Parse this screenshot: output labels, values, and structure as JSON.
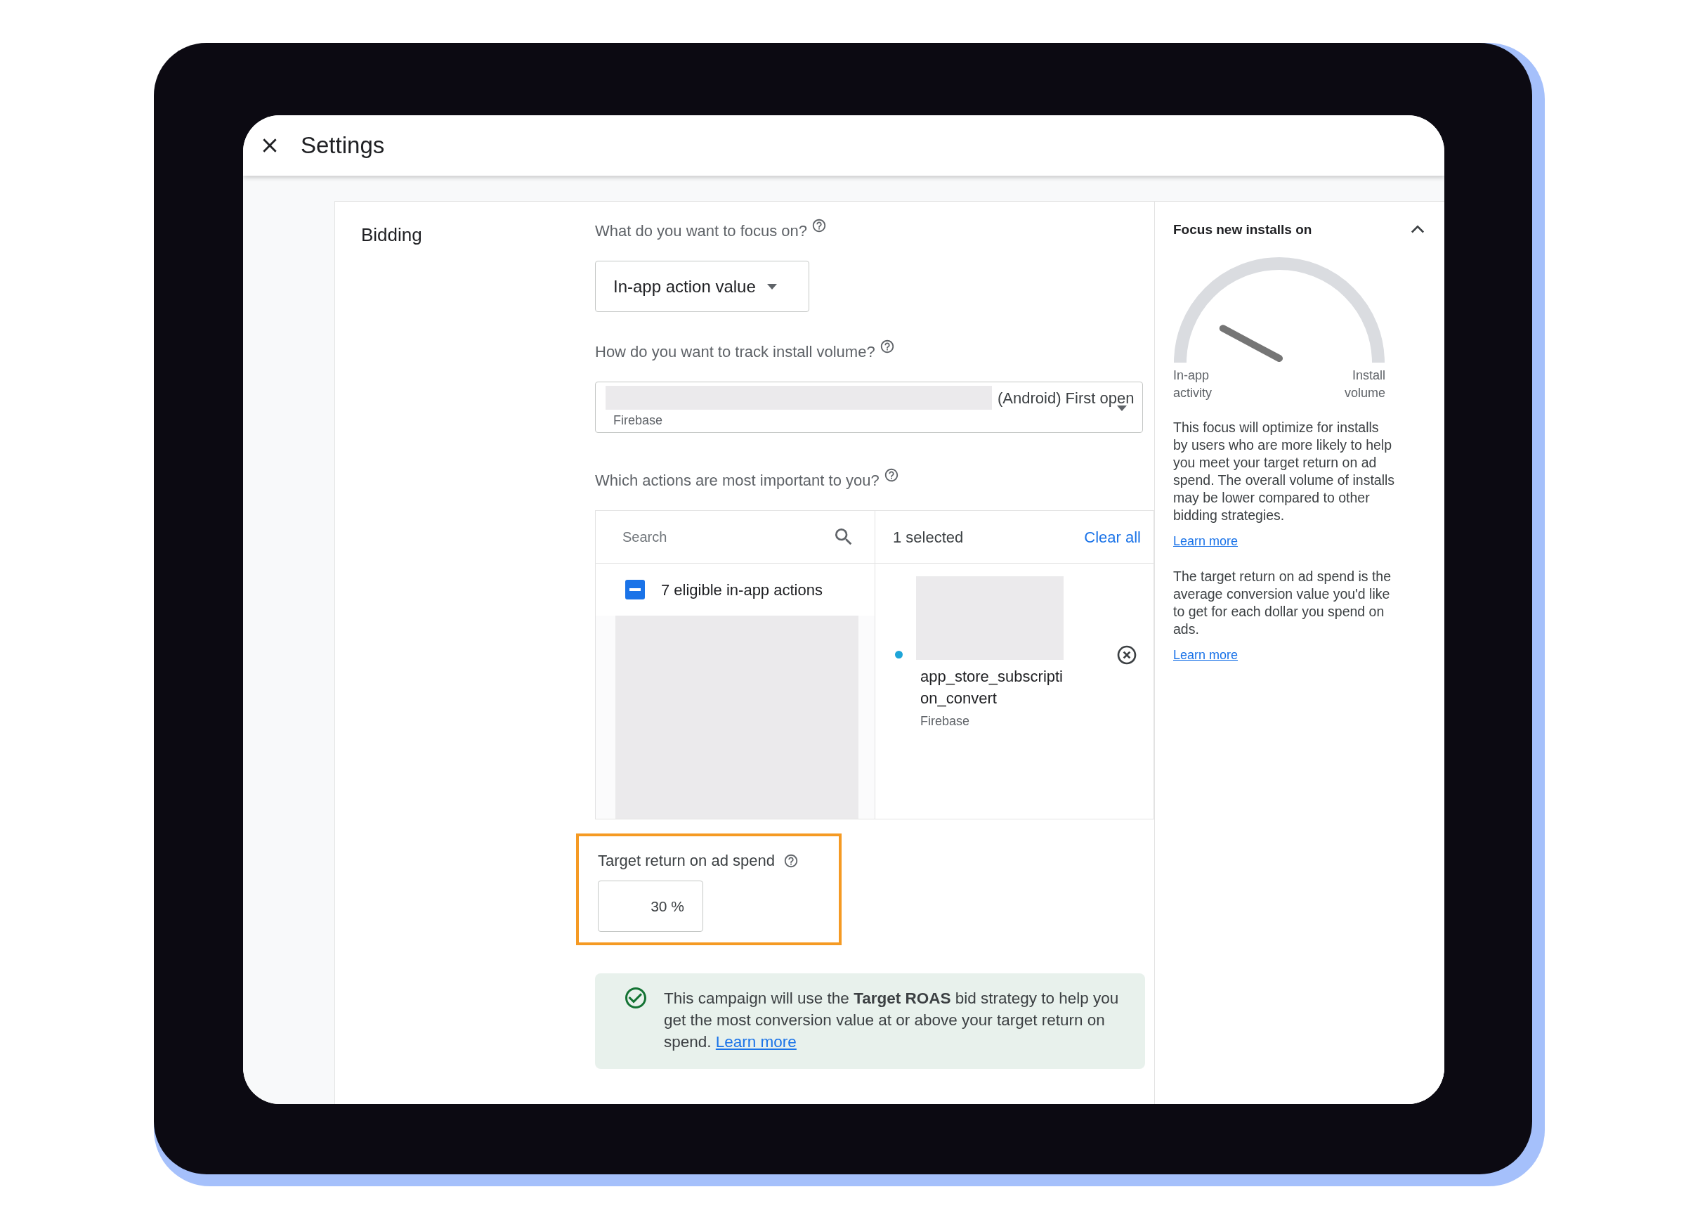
{
  "dialog": {
    "title": "Settings"
  },
  "section": {
    "title": "Bidding"
  },
  "focus_question": {
    "label": "What do you want to focus on?"
  },
  "focus_dropdown": {
    "value": "In-app action value"
  },
  "install_question": {
    "label": "How do you want to track install volume?"
  },
  "install_field": {
    "value": "(Android) First open",
    "source": "Firebase"
  },
  "actions_question": {
    "label": "Which actions are most important to you?"
  },
  "action_picker": {
    "search": {
      "placeholder": "Search"
    },
    "group": {
      "label": "7 eligible in-app actions",
      "indeterminate": true
    },
    "selected_count": "1 selected",
    "clear_label": "Clear all",
    "selected_items": [
      {
        "name": "app_store_subscription_convert",
        "source": "Firebase"
      }
    ]
  },
  "target_roas": {
    "label": "Target return on ad spend",
    "value": "30 %",
    "highlighted": true
  },
  "banner": {
    "text": "This campaign will use the **Target ROAS** bid strategy to help you get the most conversion value at or above your target return on spend.",
    "link": "Learn more"
  },
  "side_panel": {
    "title": "Focus new installs on",
    "expanded": true,
    "gauge": {
      "left_label": "In-app activity",
      "right_label": "Install volume"
    },
    "paragraphs": [
      {
        "text": "This focus will optimize for installs by users who are more likely to help you meet your target return on ad spend. The overall volume of installs may be lower compared to other bidding strategies.",
        "link": "Learn more"
      },
      {
        "text": "The target return on ad spend is the average conversion value you'd like to get for each dollar you spend on ads.",
        "link": "Learn more"
      }
    ]
  }
}
